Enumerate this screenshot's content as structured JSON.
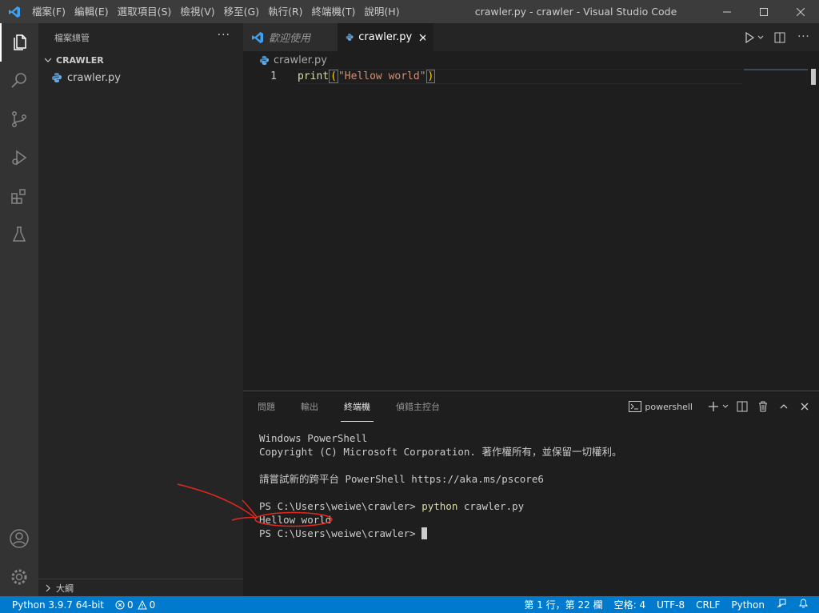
{
  "titlebar": {
    "menu": [
      "檔案(F)",
      "編輯(E)",
      "選取項目(S)",
      "檢視(V)",
      "移至(G)",
      "執行(R)",
      "終端機(T)",
      "說明(H)"
    ],
    "window_title": "crawler.py - crawler - Visual Studio Code",
    "icons": [
      "vscode-logo",
      "minimize-icon",
      "maximize-icon",
      "close-icon"
    ]
  },
  "activitybar": [
    "explorer-icon",
    "search-icon",
    "source-control-icon",
    "run-debug-icon",
    "extensions-icon",
    "testing-icon",
    "accounts-icon",
    "settings-gear-icon"
  ],
  "sidebar": {
    "header": "檔案總管",
    "more": "···",
    "folder": "CRAWLER",
    "files": [
      {
        "name": "crawler.py"
      }
    ],
    "outline": "大綱"
  },
  "tabs": [
    {
      "label": "歡迎使用",
      "active": false
    },
    {
      "label": "crawler.py",
      "active": true
    }
  ],
  "breadcrumb": "crawler.py",
  "editor": {
    "line_number": "1",
    "code": {
      "fn": "print",
      "open": "(",
      "str": "\"Hellow world\"",
      "close": ")"
    }
  },
  "panel": {
    "tabs": [
      "問題",
      "輸出",
      "終端機",
      "偵錯主控台"
    ],
    "active_tab": "終端機",
    "shell": "powershell",
    "terminal": {
      "line1": "Windows PowerShell",
      "line2": "Copyright (C) Microsoft Corporation. 著作權所有，並保留一切權利。",
      "line3": "",
      "line4": "請嘗試新的跨平台 PowerShell https://aka.ms/pscore6",
      "line5": "",
      "prompt": "PS C:\\Users\\weiwe\\crawler> ",
      "cmd_bin": "python",
      "cmd_arg": " crawler.py",
      "output": "Hellow world"
    }
  },
  "statusbar": {
    "python": "Python 3.9.7 64-bit",
    "errors": "0",
    "warnings": "0",
    "position": "第 1 行，第 22 欄",
    "indent": "空格: 4",
    "encoding": "UTF-8",
    "eol": "CRLF",
    "language": "Python"
  },
  "colors": {
    "statusbar": "#007acc",
    "annotation": "#e0281e"
  }
}
